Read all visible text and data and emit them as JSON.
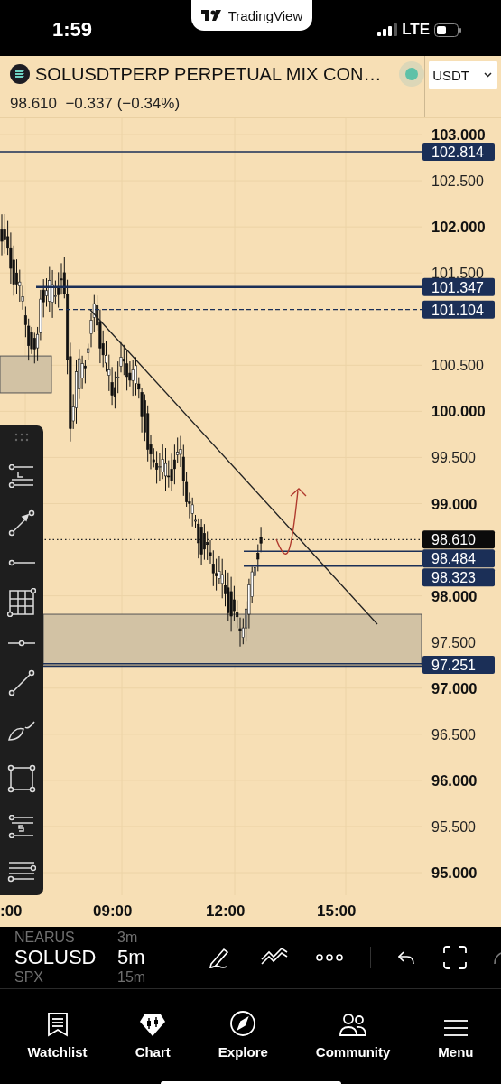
{
  "status_bar": {
    "time": "1:59",
    "network": "LTE"
  },
  "notch_app": {
    "name": "TradingView"
  },
  "header": {
    "symbol": "SOLUSDTPERP PERPETUAL MIX CON…",
    "price": "98.610",
    "change": "−0.337",
    "change_percent": "(−0.34%)",
    "currency": "USDT"
  },
  "price_axis": {
    "ticks": [
      {
        "label": "103.000",
        "major": true
      },
      {
        "label": "102.500",
        "major": false
      },
      {
        "label": "102.000",
        "major": true
      },
      {
        "label": "101.500",
        "major": false
      },
      {
        "label": "100.500",
        "major": false
      },
      {
        "label": "100.000",
        "major": true
      },
      {
        "label": "99.500",
        "major": false
      },
      {
        "label": "99.000",
        "major": true
      },
      {
        "label": "98.000",
        "major": true
      },
      {
        "label": "97.500",
        "major": false
      },
      {
        "label": "97.000",
        "major": true
      },
      {
        "label": "96.500",
        "major": false
      },
      {
        "label": "96.000",
        "major": true
      },
      {
        "label": "95.500",
        "major": false
      },
      {
        "label": "95.000",
        "major": true
      }
    ]
  },
  "price_tags": [
    {
      "value": "102.814",
      "kind": "solid"
    },
    {
      "value": "101.347",
      "kind": "thick"
    },
    {
      "value": "101.104",
      "kind": "dashed"
    },
    {
      "value": "98.610",
      "kind": "dotted"
    },
    {
      "value": "98.484",
      "kind": "solid"
    },
    {
      "value": "98.323",
      "kind": "solid"
    },
    {
      "value": "97.251",
      "kind": "double"
    }
  ],
  "time_axis": {
    "labels": [
      ":00",
      "09:00",
      "12:00",
      "15:00"
    ]
  },
  "bottom_toolbar": {
    "symbols": [
      {
        "symbol": "NEARUS",
        "interval": "3m",
        "selected": false
      },
      {
        "symbol": "SOLUSD",
        "interval": "5m",
        "selected": true
      },
      {
        "symbol": "SPX",
        "interval": "15m",
        "selected": false
      }
    ]
  },
  "nav": [
    {
      "label": "Watchlist"
    },
    {
      "label": "Chart"
    },
    {
      "label": "Explore"
    },
    {
      "label": "Community"
    },
    {
      "label": "Menu"
    }
  ]
}
